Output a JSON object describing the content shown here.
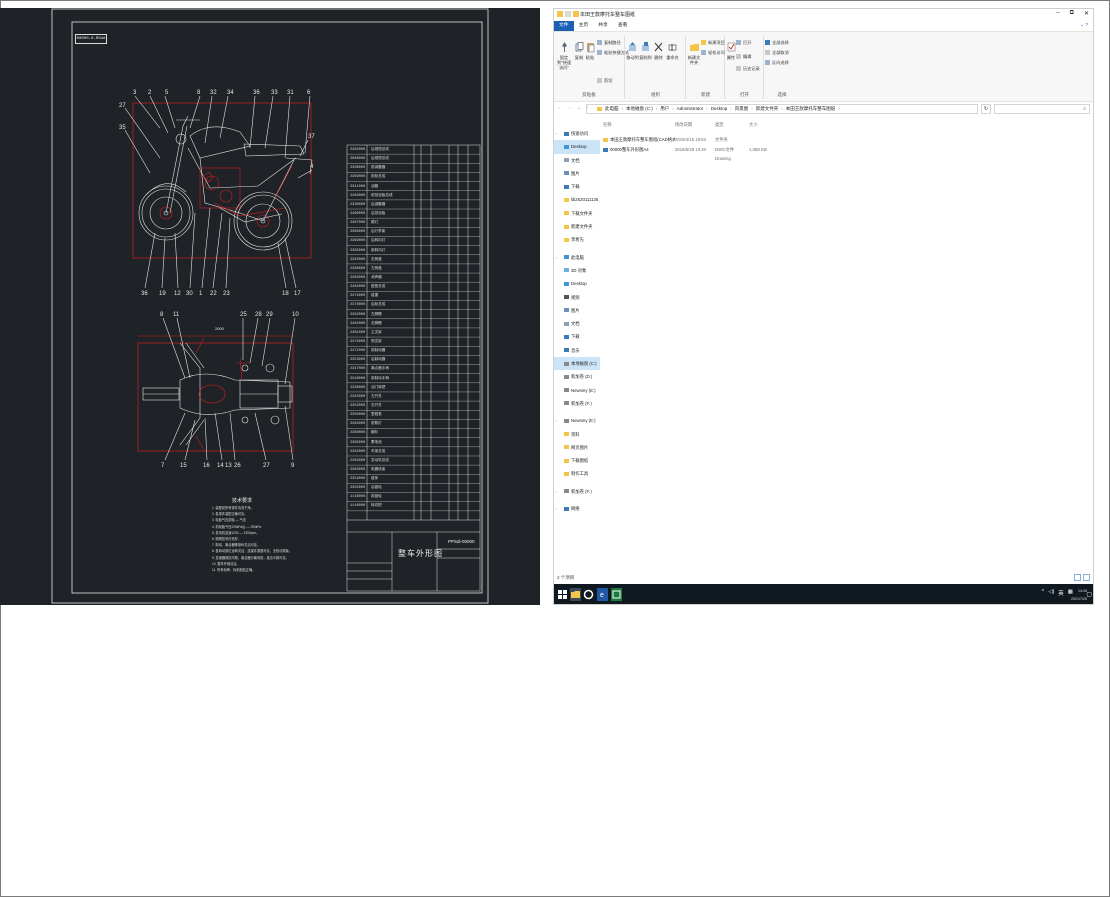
{
  "cad": {
    "drawing_label": "00000-0-RSdd",
    "title_block_title": "整车外形图",
    "drawing_number": "PPSdi-00000",
    "tech_notes_title": "技术要求",
    "tech_notes": [
      "1. 装配前所有零件清洗干净。",
      "2. 各零件装配正确可靠。",
      "3. 轮胎气压前胎 — 气压",
      "4. 前轮胎气压225kPa后 — 250kPa",
      "5. 发动机怠速1200 — 1300rpm。",
      "6. 照明信号灯完好。",
      "7. 制动、离合器等操纵灵活可靠。",
      "8. 各转动部位运转灵活，连接件紧固可靠，无松动现象。",
      "9. 变速器换挡平顺，离合器分离彻底，接合平稳可靠。",
      "10. 整车外观清洁。",
      "11. 所有标牌、标贴粘贴正确。"
    ],
    "bom_rows": [
      [
        "2382000",
        "后视镜总成"
      ],
      [
        "2686000",
        "后视镜总成"
      ],
      [
        "2308000",
        "前减震器"
      ],
      [
        "2309000",
        "前轮总成"
      ],
      [
        "2311000",
        "油箱"
      ],
      [
        "2463000",
        "前挡泥板总成"
      ],
      [
        "2330000",
        "后减震器"
      ],
      [
        "2466000",
        "后挡泥板"
      ],
      [
        "2367000",
        "尾灯"
      ],
      [
        "2366000",
        "后行李架"
      ],
      [
        "2369000",
        "后转向灯"
      ],
      [
        "2385000",
        "前转向灯"
      ],
      [
        "2345000",
        "右侧盖"
      ],
      [
        "2368000",
        "左侧盖"
      ],
      [
        "2364000",
        "消声器"
      ],
      [
        "2484000",
        "座垫总成"
      ],
      [
        "2474000",
        "链罩"
      ],
      [
        "2378000",
        "后轮总成"
      ],
      [
        "2362000",
        "左脚蹬"
      ],
      [
        "2462000",
        "右脚蹬"
      ],
      [
        "2481000",
        "主支架"
      ],
      [
        "2474000",
        "侧支架"
      ],
      [
        "2471000",
        "前制动器"
      ],
      [
        "2353000",
        "后制动器"
      ],
      [
        "2347000",
        "离合器手柄"
      ],
      [
        "2349000",
        "前制动手柄"
      ],
      [
        "2338000",
        "油门转把"
      ],
      [
        "2345000",
        "左开关"
      ],
      [
        "2352000",
        "右开关"
      ],
      [
        "2350000",
        "里程表"
      ],
      [
        "2364000",
        "前照灯"
      ],
      [
        "2360000",
        "喇叭"
      ],
      [
        "2365000",
        "蓄电池"
      ],
      [
        "2362000",
        "车架总成"
      ],
      [
        "2364000",
        "发动机总成"
      ],
      [
        "2363000",
        "电器线束"
      ],
      [
        "2354000",
        "链条"
      ],
      [
        "2355000",
        "后链轮"
      ],
      [
        "1116000",
        "前链轮"
      ],
      [
        "1116000",
        "转向把"
      ]
    ]
  },
  "explorer": {
    "window_title": "本田王款摩托车整车图纸",
    "ribbon_tabs": [
      "文件",
      "主页",
      "共享",
      "查看"
    ],
    "ribbon": {
      "clipboard": {
        "pin": "固定到\"快速访问\"",
        "copy": "复制",
        "paste": "粘贴",
        "copy_path": "复制路径",
        "paste_shortcut": "粘贴快捷方式",
        "cut": "剪切",
        "label": "剪贴板"
      },
      "organize": {
        "move_to": "移动到",
        "copy_to": "复制到",
        "delete": "删除",
        "rename": "重命名",
        "label": "组织"
      },
      "new": {
        "new_folder": "新建文件夹",
        "new_item": "新建项目",
        "easy_access": "轻松访问",
        "label": "新建"
      },
      "open": {
        "properties": "属性",
        "open": "打开",
        "edit": "编辑",
        "history": "历史记录",
        "label": "打开"
      },
      "select": {
        "select_all": "全部选择",
        "select_none": "全部取消",
        "invert": "反向选择",
        "label": "选择"
      }
    },
    "address_parts": [
      "此电脑",
      "本地磁盘 (C:)",
      "用户",
      "Administrator",
      "Desktop",
      "风景图",
      "新建文件夹",
      "本田王款摩托车整车图纸"
    ],
    "search_icon": "search-icon",
    "nav": [
      {
        "label": "快速访问",
        "type": "header",
        "icon": "star"
      },
      {
        "label": "Desktop",
        "type": "child",
        "selected": true,
        "icon": "desktop"
      },
      {
        "label": "文档",
        "type": "child",
        "icon": "doc"
      },
      {
        "label": "图片",
        "type": "child",
        "icon": "pic"
      },
      {
        "label": "下载",
        "type": "child",
        "icon": "down"
      },
      {
        "label": "lib2620111135 王玉",
        "type": "child",
        "icon": "folder"
      },
      {
        "label": "下载文件夹",
        "type": "child",
        "icon": "folder"
      },
      {
        "label": "新建文件夹",
        "type": "child",
        "icon": "folder"
      },
      {
        "label": "李希先",
        "type": "child",
        "icon": "folder"
      },
      {
        "label": "此电脑",
        "type": "header",
        "icon": "pc"
      },
      {
        "label": "3D 对象",
        "type": "child",
        "icon": "3d"
      },
      {
        "label": "Desktop",
        "type": "child",
        "icon": "desktop"
      },
      {
        "label": "视频",
        "type": "child",
        "icon": "video"
      },
      {
        "label": "图片",
        "type": "child",
        "icon": "pic"
      },
      {
        "label": "文档",
        "type": "child",
        "icon": "doc"
      },
      {
        "label": "下载",
        "type": "child",
        "icon": "down"
      },
      {
        "label": "音乐",
        "type": "child",
        "icon": "music"
      },
      {
        "label": "本地磁盘 (C:)",
        "type": "child",
        "selected": true,
        "icon": "drive"
      },
      {
        "label": "新加卷 (D:)",
        "type": "child",
        "icon": "drive"
      },
      {
        "label": "Newsmy (E:)",
        "type": "child",
        "icon": "drive"
      },
      {
        "label": "新加卷 (F:)",
        "type": "child",
        "icon": "drive"
      },
      {
        "label": "Newsmy (E:)",
        "type": "header",
        "icon": "drive"
      },
      {
        "label": "资料",
        "type": "child",
        "icon": "folder"
      },
      {
        "label": "网页图片",
        "type": "child",
        "icon": "folder"
      },
      {
        "label": "下载图纸",
        "type": "child",
        "icon": "folder"
      },
      {
        "label": "制作工具",
        "type": "child",
        "icon": "folder"
      },
      {
        "label": "新加卷 (F:)",
        "type": "header",
        "icon": "drive"
      },
      {
        "label": "网络",
        "type": "header",
        "icon": "net"
      }
    ],
    "columns": {
      "name": "名称",
      "date": "修改日期",
      "type": "类型",
      "size": "大小"
    },
    "files": [
      {
        "name": "本田王款摩托车整车图纸(CAD格式)",
        "date": "2018/4/15 19:53",
        "type": "文件夹",
        "size": "",
        "icon": "folder"
      },
      {
        "name": "00000整车外形图A4",
        "date": "2016/5/28 10:20",
        "type": "DWG文件 Drawing",
        "size": "1,088 KB",
        "icon": "dwg"
      }
    ],
    "status": "2 个项目",
    "tray": {
      "chevron": "^",
      "ime": "英",
      "time": "14:28",
      "date": "2021/7/26"
    },
    "colors": {
      "accent": "#1a5fb4",
      "selection": "#cce4f7",
      "folder": "#f3c64b",
      "taskbar": "#101820"
    }
  }
}
